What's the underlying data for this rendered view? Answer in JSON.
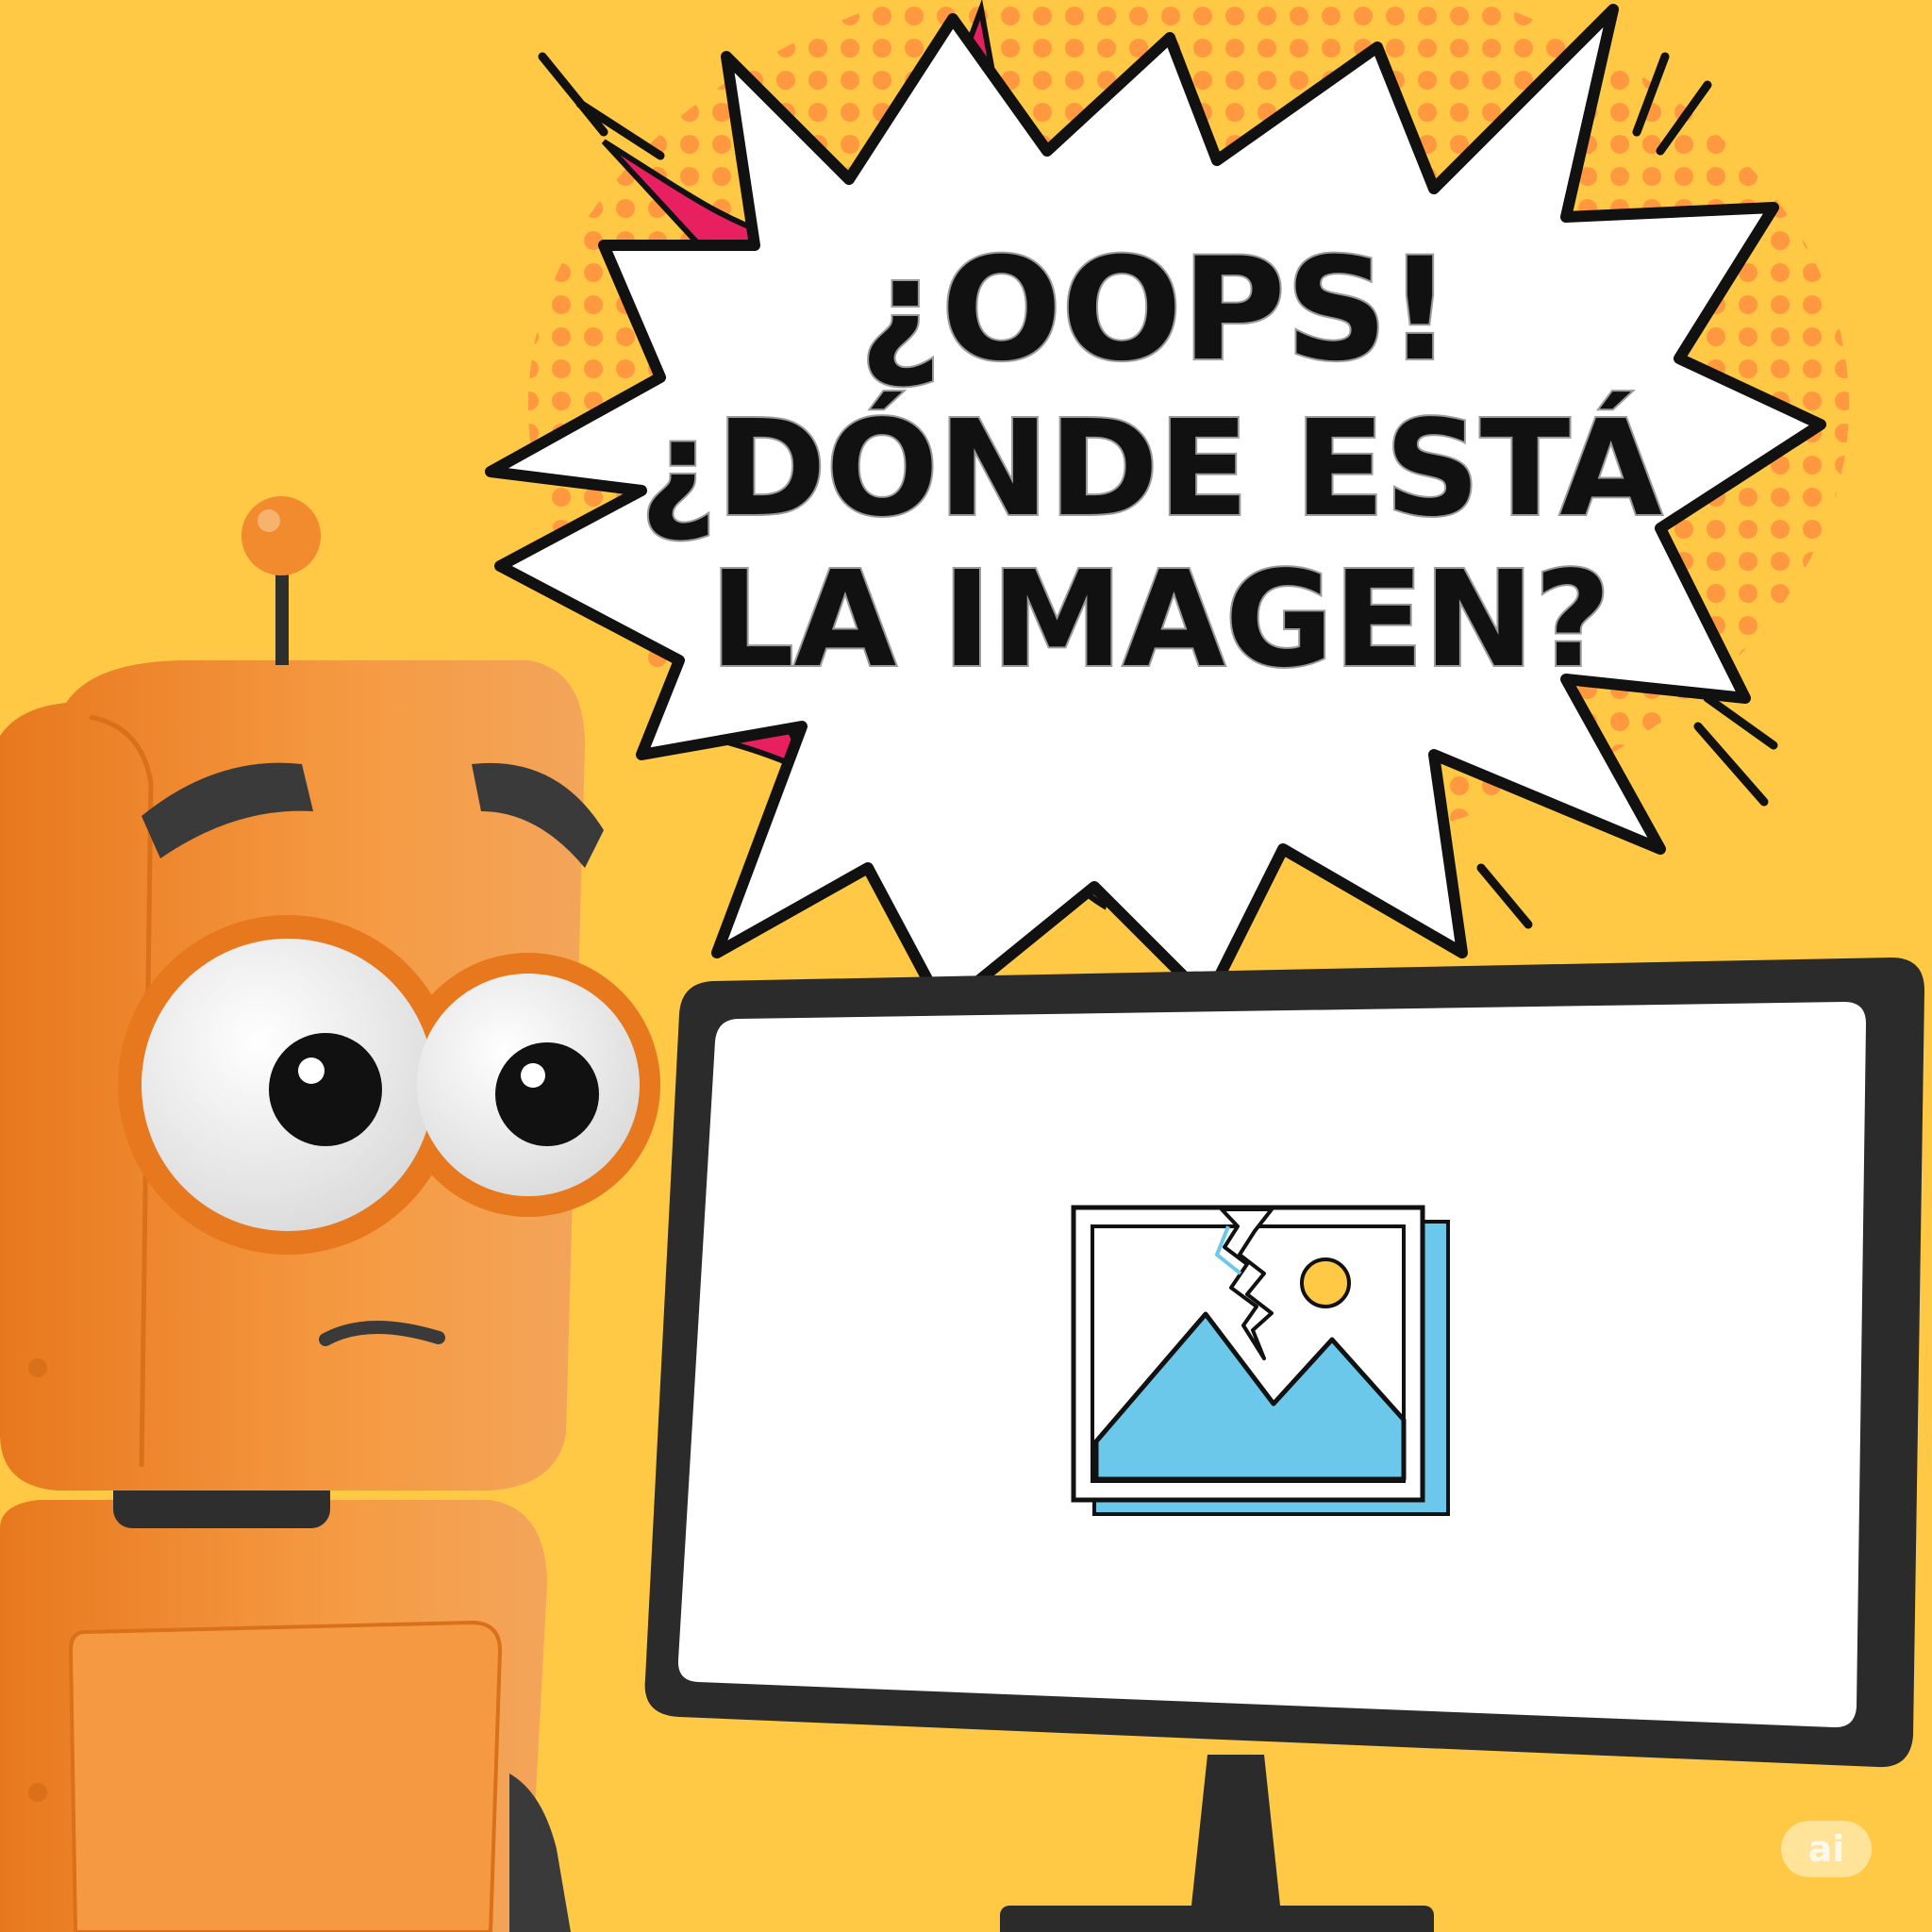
{
  "colors": {
    "background": "#FFC845",
    "halftone": "#FF8A3D",
    "burst_fill": "#FFFFFF",
    "burst_accent": "#E8205F",
    "outline": "#111111",
    "robot_body": "#F28A2E",
    "robot_shadow": "#D9701A",
    "robot_eyebrow": "#3A3A3A",
    "monitor_frame": "#2B2B2B",
    "screen": "#FFFFFF",
    "mountain": "#6BC8EA",
    "sun": "#FFC845"
  },
  "speech_burst": {
    "line1": "¿OOPS!",
    "line2": "¿DÓNDE ESTÁ",
    "line3": "LA IMAGEN?"
  },
  "icons": {
    "screen": "broken-image-icon",
    "badge": "ai-logo"
  },
  "badge": {
    "label": "ai"
  }
}
